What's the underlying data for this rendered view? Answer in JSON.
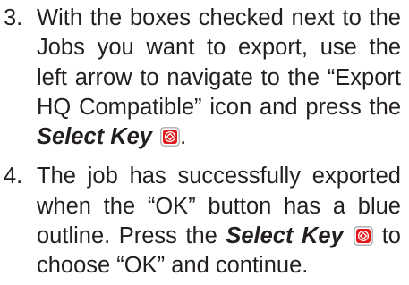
{
  "steps": [
    {
      "number": "3.",
      "text_before": "With the boxes checked next to the Jobs you want to export, use the left arrow to navigate to the “Export HQ Compatible” icon and press the ",
      "key_label": "Select Key",
      "text_after": ".",
      "key_icon": "select-key-icon"
    },
    {
      "number": "4.",
      "text_before": "The job has successfully exported when the “OK” button has a blue outline. Press the ",
      "key_label": "Select Key",
      "text_after": " to choose “OK” and continue.",
      "key_icon": "select-key-icon"
    }
  ],
  "colors": {
    "text": "#231f20",
    "key_icon_fill": "#e2191d",
    "key_icon_border": "#b3b3b3"
  }
}
